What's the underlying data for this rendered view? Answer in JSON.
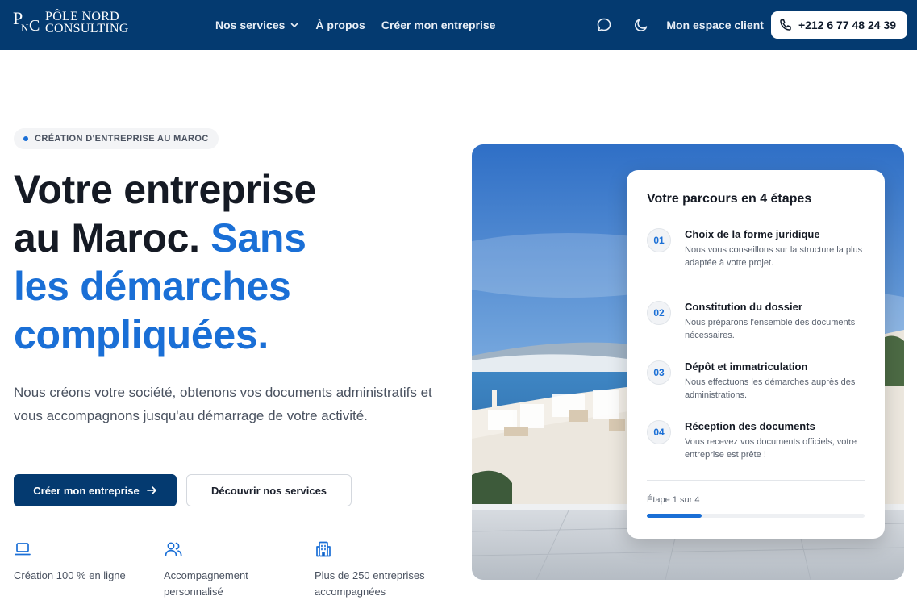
{
  "brand": {
    "logo_letters": [
      "P",
      "N",
      "C"
    ],
    "name_line1": "PÔLE NORD",
    "name_line2": "CONSULTING"
  },
  "nav": {
    "links": [
      {
        "label": "Nos services",
        "icon": "chevron-down-icon"
      },
      {
        "label": "À propos"
      },
      {
        "label": "Créer mon entreprise"
      }
    ],
    "chat_icon": "chat-bubble-icon",
    "theme_icon": "moon-icon",
    "client_label": "Mon espace client",
    "phone_icon": "phone-icon",
    "phone": "+212 6 77 48 24 39"
  },
  "hero": {
    "badge": "CRÉATION D'ENTREPRISE AU MAROC",
    "title_line1": "Votre entreprise",
    "title_line2_dark": "au Maroc.",
    "title_line2_blue": "Sans",
    "title_line3": "les démarches",
    "title_line4": "compliquées.",
    "description": "Nous créons votre société, obtenons vos documents administratifs et vous accompagnons jusqu'au démarrage de votre activité.",
    "primary_button": "Créer mon entreprise",
    "primary_icon": "arrow-right-icon",
    "secondary_button": "Découvrir nos services",
    "features": [
      {
        "icon": "laptop-icon",
        "text": "Création 100 % en ligne"
      },
      {
        "icon": "users-icon",
        "text": "Accompagnement personnalisé"
      },
      {
        "icon": "building-icon",
        "text": "Plus de 250 entreprises accompagnées"
      }
    ]
  },
  "steps_card": {
    "title": "Votre parcours en 4 étapes",
    "steps": [
      {
        "num": "01",
        "title": "Choix de la forme juridique",
        "desc": "Nous vous conseillons sur la structure la plus adaptée à votre projet."
      },
      {
        "num": "02",
        "title": "Constitution du dossier",
        "desc": "Nous préparons l'ensemble des documents nécessaires."
      },
      {
        "num": "03",
        "title": "Dépôt et immatriculation",
        "desc": "Nous effectuons les démarches auprès des administrations."
      },
      {
        "num": "04",
        "title": "Réception des documents",
        "desc": "Vous recevez vos documents officiels, votre entreprise est prête !"
      }
    ],
    "progress_label": "Étape 1 sur 4",
    "progress_fraction": 0.25
  },
  "colors": {
    "nav_bg": "#043a70",
    "accent_blue": "#1a6fd6",
    "primary_button": "#043a70"
  }
}
